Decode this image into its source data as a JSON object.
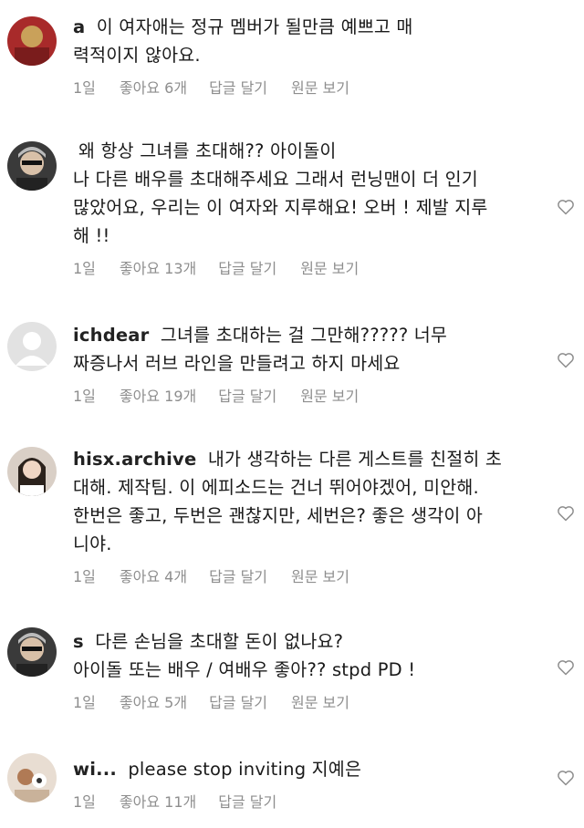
{
  "comments": [
    {
      "username": "a",
      "username_tail": "",
      "text_lines": [
        "이 여자애는 정규 멤버가 될만큼 예쁘고 매",
        "력적이지 않아요."
      ],
      "time": "1일",
      "likes": "좋아요 6개",
      "reply": "답글 달기",
      "original": "원문 보기",
      "show_heart": false
    },
    {
      "username": "",
      "username_tail": "",
      "text_lines": [
        "왜 항상 그녀를 초대해?? 아이돌이",
        "나 다른 배우를 초대해주세요 그래서 런닝맨이 더 인기",
        "많았어요, 우리는 이 여자와 지루해요! 오버 ! 제발 지루",
        "해 !!"
      ],
      "time": "1일",
      "likes": "좋아요 13개",
      "reply": "답글 달기",
      "original": "원문 보기",
      "show_heart": true
    },
    {
      "username": "ichdear",
      "username_tail": "",
      "text_lines": [
        "그녀를 초대하는 걸 그만해????? 너무",
        "짜증나서 러브 라인을 만들려고 하지 마세요"
      ],
      "time": "1일",
      "likes": "좋아요 19개",
      "reply": "답글 달기",
      "original": "원문 보기",
      "show_heart": true
    },
    {
      "username": "hisx.archive",
      "username_tail": "",
      "text_lines": [
        "내가 생각하는 다른 게스트를 친절히 초",
        "대해. 제작팀. 이 에피소드는 건너 뛰어야겠어, 미안해.",
        "한번은 좋고, 두번은 괜찮지만, 세번은? 좋은 생각이 아",
        "니야."
      ],
      "time": "1일",
      "likes": "좋아요 4개",
      "reply": "답글 달기",
      "original": "원문 보기",
      "show_heart": true
    },
    {
      "username": "s",
      "username_tail": "",
      "text_lines": [
        "다른 손님을 초대할 돈이 없나요?",
        "아이돌 또는 배우 / 여배우 좋아?? stpd PD !"
      ],
      "time": "1일",
      "likes": "좋아요 5개",
      "reply": "답글 달기",
      "original": "원문 보기",
      "show_heart": true
    },
    {
      "username": "wi...",
      "username_tail": "",
      "text_lines": [
        "please stop inviting 지예은"
      ],
      "time": "1일",
      "likes": "좋아요 11개",
      "reply": "답글 달기",
      "original": "",
      "show_heart": true
    }
  ],
  "icons": {
    "like": "heart-outline-icon"
  },
  "colors": {
    "meta": "#8e8e8e",
    "text": "#1a1a1a"
  }
}
